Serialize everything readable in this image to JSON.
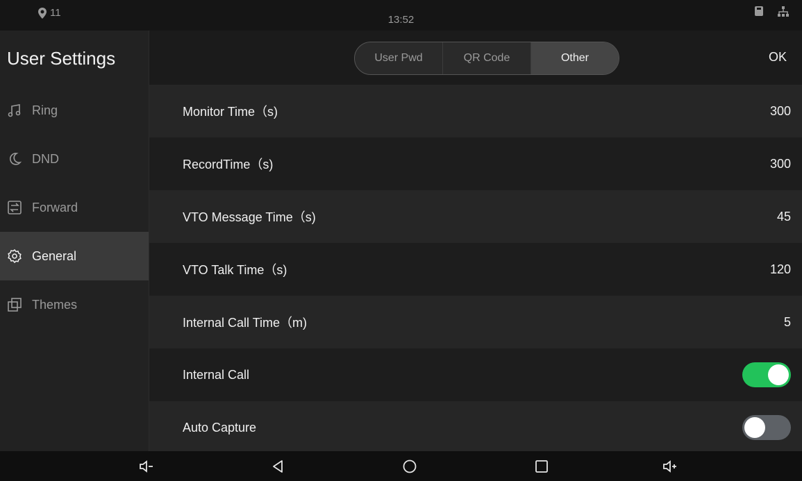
{
  "status_bar": {
    "location_count": "11",
    "time": "13:52",
    "icons": [
      "sd-card-icon",
      "network-icon"
    ]
  },
  "sidebar": {
    "title": "User Settings",
    "items": [
      {
        "label": "Ring",
        "icon": "music-note-icon",
        "active": false
      },
      {
        "label": "DND",
        "icon": "moon-icon",
        "active": false
      },
      {
        "label": "Forward",
        "icon": "forward-icon",
        "active": false
      },
      {
        "label": "General",
        "icon": "gear-icon",
        "active": true
      },
      {
        "label": "Themes",
        "icon": "themes-icon",
        "active": false
      }
    ]
  },
  "tabs": {
    "items": [
      {
        "label": "User Pwd",
        "active": false
      },
      {
        "label": "QR Code",
        "active": false
      },
      {
        "label": "Other",
        "active": true
      }
    ],
    "ok_label": "OK"
  },
  "settings": [
    {
      "label": "Monitor Time（s)",
      "value": "300"
    },
    {
      "label": "RecordTime（s)",
      "value": "300"
    },
    {
      "label": "VTO Message Time（s)",
      "value": "45"
    },
    {
      "label": "VTO Talk Time（s)",
      "value": "120"
    },
    {
      "label": "Internal Call Time（m)",
      "value": "5"
    },
    {
      "label": "Internal Call",
      "toggle": true
    },
    {
      "label": "Auto Capture",
      "toggle": false
    }
  ],
  "colors": {
    "toggle_on": "#22c25a",
    "toggle_off": "#5d6166",
    "active_bg": "#3a3a3a"
  },
  "nav_bar": {
    "buttons": [
      "volume-down-icon",
      "back-icon",
      "home-icon",
      "recents-icon",
      "volume-up-icon"
    ]
  }
}
